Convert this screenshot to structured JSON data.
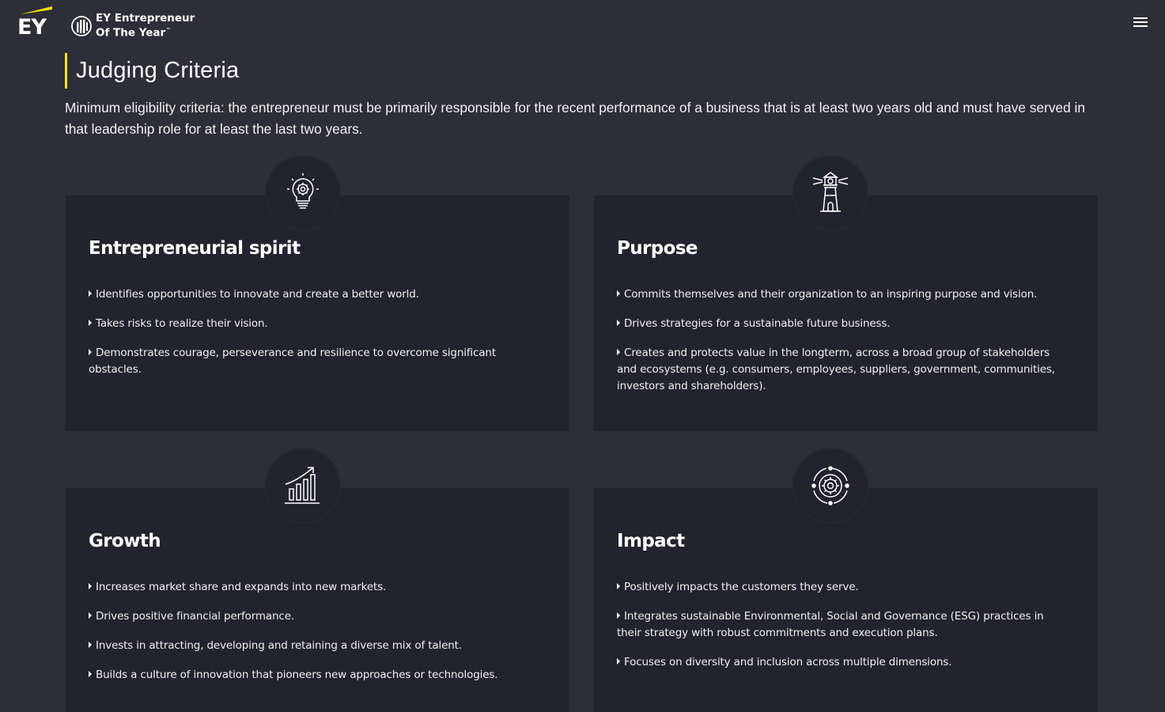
{
  "header": {
    "brand": "EY",
    "program_line1": "EY Entrepreneur",
    "program_line2": "Of The Year",
    "trademark": "™",
    "menu_icon": "hamburger-menu-icon"
  },
  "page": {
    "title": "Judging Criteria",
    "intro": "Minimum eligibility criteria: the entrepreneur must be primarily responsible for the recent performance of a business that is at least two years old and must have served in that leadership role for at least the last two years."
  },
  "colors": {
    "background": "#2e2e38",
    "card": "#23232f",
    "accent": "#ffe600",
    "text": "#ffffff"
  },
  "criteria": [
    {
      "title": "Entrepreneurial spirit",
      "icon": "lightbulb-gear-icon",
      "items": [
        "Identifies opportunities to innovate and create a better world.",
        "Takes risks to realize their vision.",
        "Demonstrates courage, perseverance and resilience to overcome significant obstacles."
      ]
    },
    {
      "title": "Purpose",
      "icon": "lighthouse-icon",
      "items": [
        "Commits themselves and their organization to an inspiring purpose and vision.",
        "Drives strategies for a sustainable future business.",
        "Creates and protects value in the longterm, across a broad group of stakeholders and ecosystems (e.g. consumers, employees, suppliers, government, communities, investors and shareholders)."
      ]
    },
    {
      "title": "Growth",
      "icon": "growth-chart-icon",
      "items": [
        "Increases market share and expands into new markets.",
        "Drives positive financial performance.",
        "Invests in attracting, developing and retaining a diverse mix of talent.",
        "Builds a culture of innovation that pioneers new approaches or technologies."
      ]
    },
    {
      "title": "Impact",
      "icon": "cycle-gear-icon",
      "items": [
        "Positively impacts the customers they serve.",
        "Integrates sustainable Environmental, Social and Governance (ESG) practices in their strategy with robust commitments and execution plans.",
        "Focuses on diversity and inclusion across multiple dimensions."
      ]
    }
  ]
}
